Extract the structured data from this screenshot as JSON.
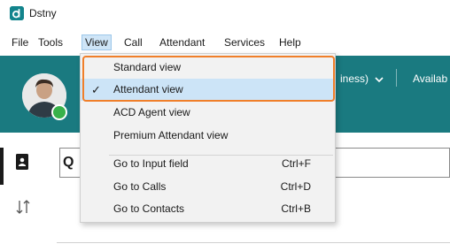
{
  "app": {
    "title": "Dstny",
    "logo_letter": "d"
  },
  "menubar": {
    "items": [
      {
        "label": "File"
      },
      {
        "label": "Tools"
      },
      {
        "label": "View"
      },
      {
        "label": "Call"
      },
      {
        "label": "Attendant"
      },
      {
        "label": "Services"
      },
      {
        "label": "Help"
      }
    ],
    "active": "View"
  },
  "header": {
    "status_label": "iness)",
    "availability_label": "Availab",
    "presence_color": "#38b14a",
    "bar_color": "#1a7a80"
  },
  "view_menu": {
    "items": [
      {
        "label": "Standard view",
        "shortcut": "",
        "checked": false
      },
      {
        "label": "Attendant view",
        "shortcut": "",
        "checked": true
      },
      {
        "label": "ACD Agent view",
        "shortcut": "",
        "checked": false
      },
      {
        "label": "Premium Attendant view",
        "shortcut": "",
        "checked": false
      },
      {
        "label": "Go to Input field",
        "shortcut": "Ctrl+F",
        "checked": false
      },
      {
        "label": "Go to Calls",
        "shortcut": "Ctrl+D",
        "checked": false
      },
      {
        "label": "Go to Contacts",
        "shortcut": "Ctrl+B",
        "checked": false
      }
    ],
    "check_glyph": "✓",
    "highlight_color": "#f07f2a"
  },
  "sidebar": {
    "icons": [
      "contacts-book-icon",
      "swap-arrows-icon"
    ]
  },
  "search": {
    "glyph": "Q"
  }
}
